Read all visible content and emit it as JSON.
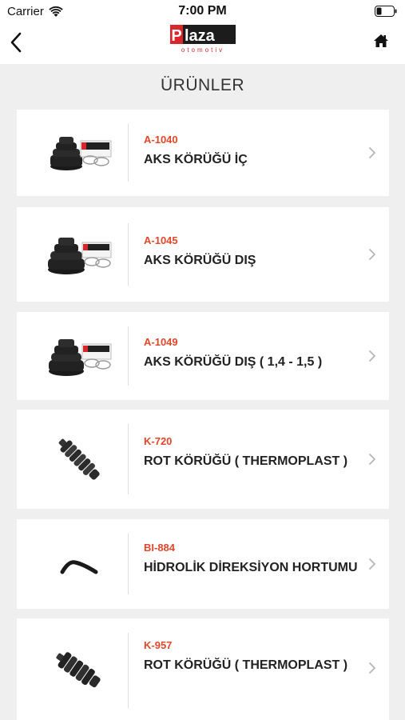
{
  "status_bar": {
    "carrier": "Carrier",
    "time": "7:00 PM"
  },
  "nav": {
    "logo_text": "Plaza",
    "logo_subtext": "otomotiv"
  },
  "page": {
    "title": "ÜRÜNLER"
  },
  "products": [
    {
      "code": "A-1040",
      "name": "AKS KÖRÜĞÜ İÇ",
      "image": "boot-kit-small"
    },
    {
      "code": "A-1045",
      "name": "AKS KÖRÜĞÜ DIŞ",
      "image": "boot-kit-large"
    },
    {
      "code": "A-1049",
      "name": "AKS KÖRÜĞÜ DIŞ ( 1,4 - 1,5 )",
      "image": "boot-kit-large"
    },
    {
      "code": "K-720",
      "name": "ROT KÖRÜĞÜ ( THERMOPLAST )",
      "image": "rack-boot"
    },
    {
      "code": "BI-884",
      "name": "HİDROLİK DİREKSİYON HORTUMU",
      "image": "hydraulic-hose"
    },
    {
      "code": "K-957",
      "name": "ROT KÖRÜĞÜ ( THERMOPLAST )",
      "image": "rack-boot"
    }
  ],
  "colors": {
    "accent": "#e0462a",
    "background": "#efefef"
  }
}
